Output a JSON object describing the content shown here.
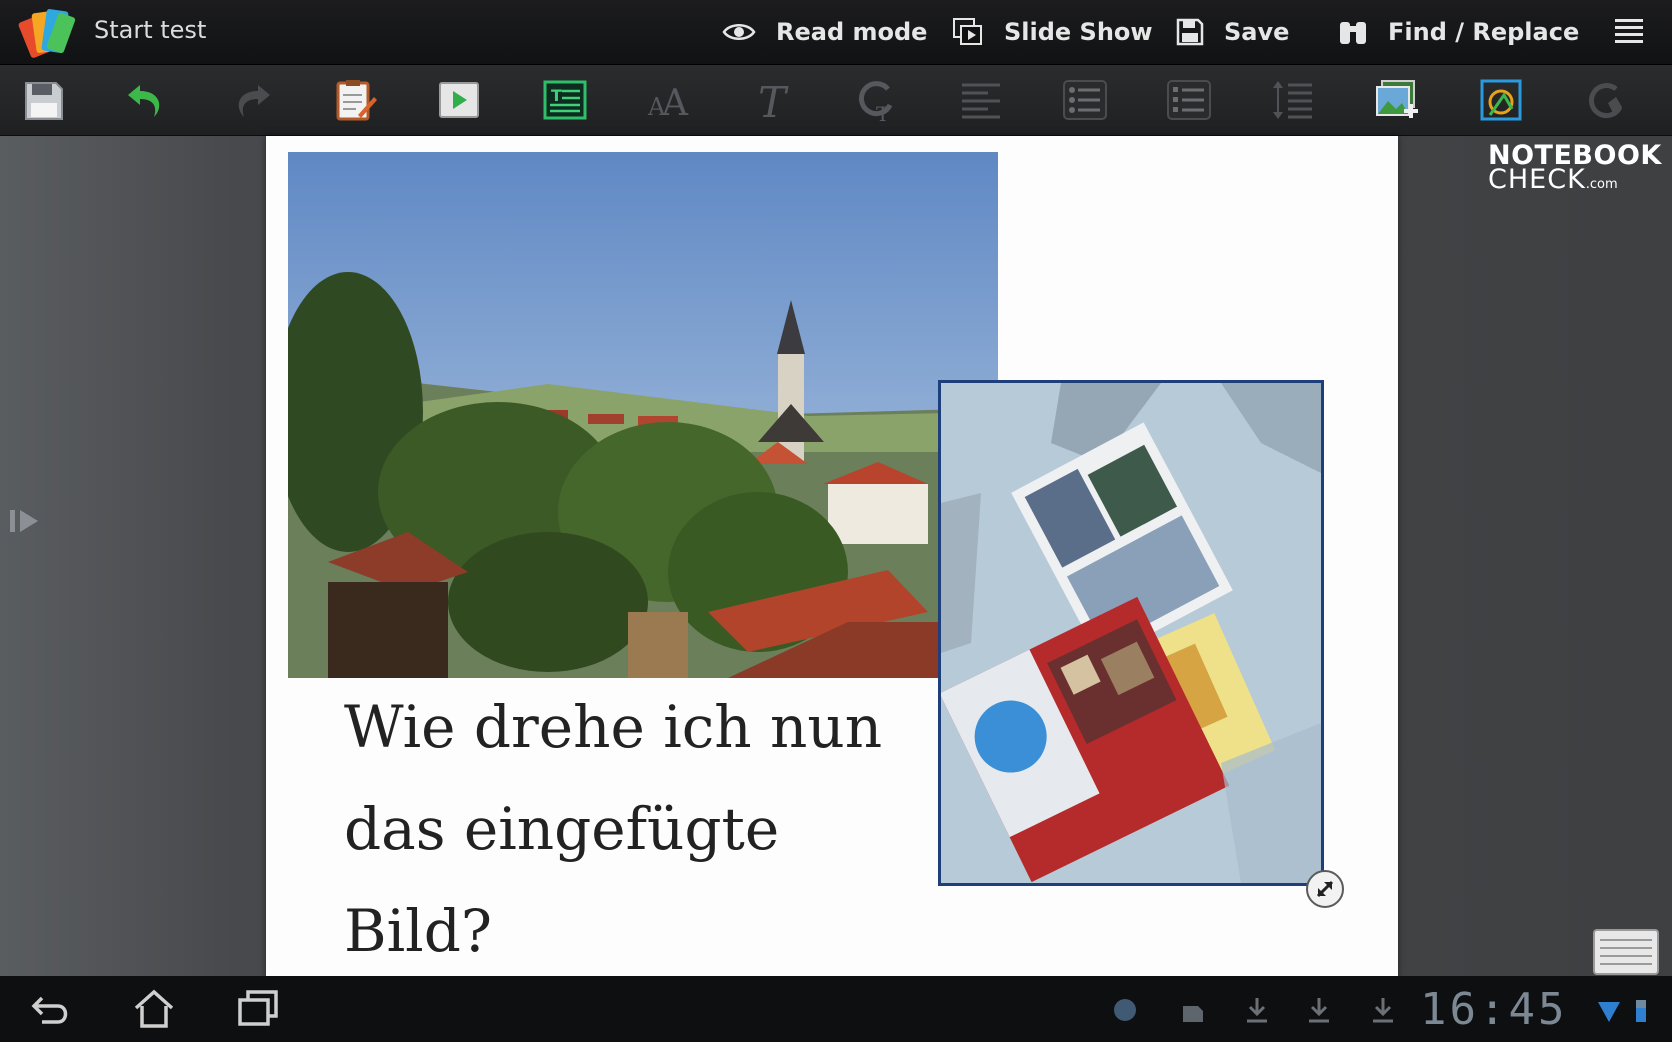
{
  "actionbar": {
    "title": "Start test",
    "actions": [
      {
        "label": "Read mode",
        "icon": "eye-icon"
      },
      {
        "label": "Slide Show",
        "icon": "slideshow-icon"
      },
      {
        "label": "Save",
        "icon": "floppy-icon"
      },
      {
        "label": "Find / Replace",
        "icon": "binoculars-icon"
      }
    ],
    "menu_icon": "overflow-menu-icon"
  },
  "toolbar": {
    "tools": [
      {
        "name": "save",
        "icon": "floppy-icon",
        "enabled": true
      },
      {
        "name": "undo",
        "icon": "undo-icon",
        "enabled": true
      },
      {
        "name": "redo",
        "icon": "redo-icon",
        "enabled": false
      },
      {
        "name": "notes",
        "icon": "notepad-pen-icon",
        "enabled": true
      },
      {
        "name": "play-slide",
        "icon": "play-slide-icon",
        "enabled": true
      },
      {
        "name": "insert-text-box",
        "icon": "text-box-icon",
        "enabled": true,
        "active": true
      },
      {
        "name": "font-size",
        "icon": "font-size-icon",
        "enabled": false
      },
      {
        "name": "text-style",
        "icon": "italic-t-icon",
        "enabled": false
      },
      {
        "name": "text-color",
        "icon": "text-color-icon",
        "enabled": false
      },
      {
        "name": "align",
        "icon": "align-left-icon",
        "enabled": false
      },
      {
        "name": "bullet-list",
        "icon": "bullet-list-icon",
        "enabled": false
      },
      {
        "name": "numbered-list",
        "icon": "numbered-list-icon",
        "enabled": false
      },
      {
        "name": "line-spacing",
        "icon": "line-spacing-icon",
        "enabled": false
      },
      {
        "name": "insert-picture",
        "icon": "insert-picture-icon",
        "enabled": true
      },
      {
        "name": "insert-shape",
        "icon": "insert-shape-icon",
        "enabled": true
      },
      {
        "name": "fill-color",
        "icon": "fill-color-icon",
        "enabled": false
      }
    ]
  },
  "slide": {
    "text_line1": "Wie drehe ich nun",
    "text_line2": "das eingefügte Bild?"
  },
  "watermark": {
    "line1": "NOTEBOOK",
    "line2": "CHECK",
    "suffix": ".com"
  },
  "navbar": {
    "clock": "16:45",
    "buttons": [
      "back-icon",
      "home-icon",
      "recent-apps-icon"
    ]
  },
  "colors": {
    "active_tool": "#2fbf6a",
    "undo_green": "#3cb84b",
    "selection_border": "#1f3f7a",
    "clock": "#7c8994"
  }
}
